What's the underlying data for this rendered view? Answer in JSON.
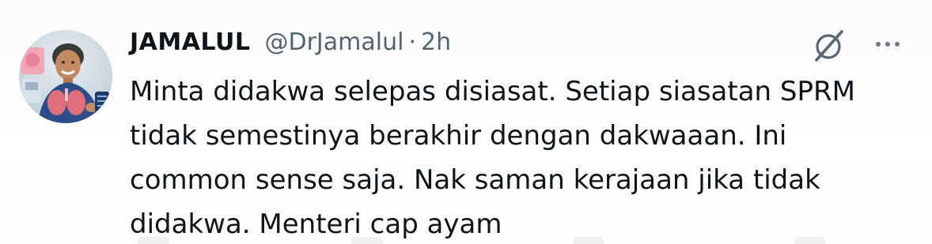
{
  "tweet": {
    "display_name": "JAMALUL",
    "handle": "@DrJamalul",
    "separator": "·",
    "time": "2h",
    "text_lines": [
      "Minta didakwa selepas disiasat. Setiap siasatan SPRM",
      "tidak semestinya berakhir dengan dakwaaan. Ini",
      "common sense saja. Nak saman kerajaan jika tidak",
      "didakwa. Menteri cap ayam"
    ]
  },
  "icons": {
    "grok": "grok-icon",
    "more": "more-options-icon",
    "avatar": "profile-avatar"
  },
  "colors": {
    "text_primary": "#0f1419",
    "text_secondary": "#536471"
  }
}
